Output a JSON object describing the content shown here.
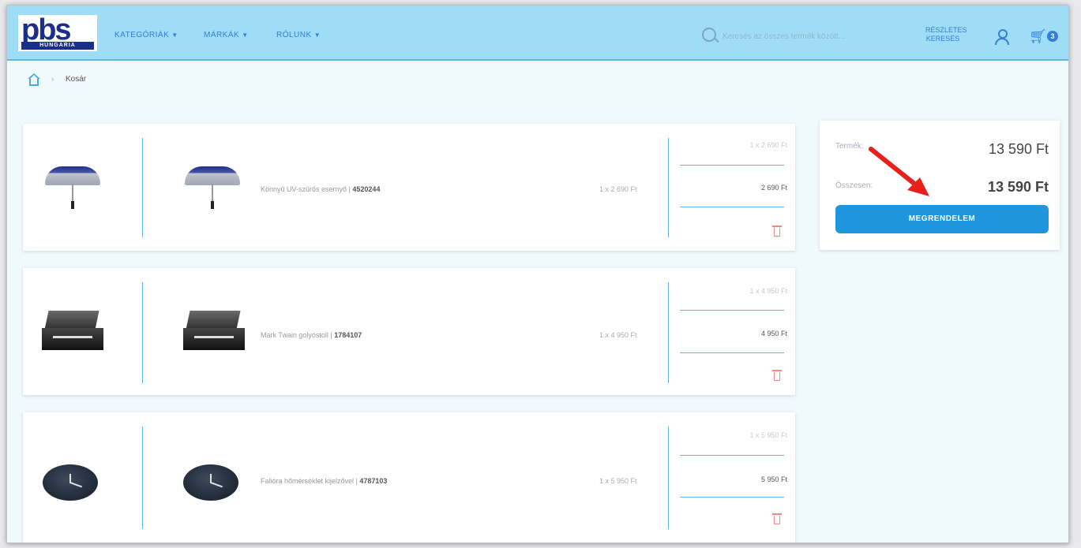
{
  "logo": {
    "word": "pbs",
    "sub": "HUNGARIA"
  },
  "nav": [
    {
      "label": "KATEGÓRIÁK"
    },
    {
      "label": "MÁRKÁK"
    },
    {
      "label": "RÓLUNK"
    }
  ],
  "search": {
    "placeholder": "Keresés az összes termék között..."
  },
  "advanced_search": "RÉSZLETES KERESÉS",
  "cart": {
    "count": "3"
  },
  "breadcrumb": {
    "separator": "›",
    "current": "Kosár"
  },
  "items": [
    {
      "name": "Könnyű UV-szűrős esernyő",
      "code": "4520244",
      "qty_price": "1 x 2 690 Ft",
      "unit_line": "1 x 2 690 Ft",
      "total": "2 690 Ft"
    },
    {
      "name": "Mark Twain golyóstoll",
      "code": "1784107",
      "qty_price": "1 x 4 950 Ft",
      "unit_line": "1 x 4 950 Ft",
      "total": "4 950 Ft"
    },
    {
      "name": "Falióra hőmérséklet kijelzővel",
      "code": "4787103",
      "qty_price": "1 x 5 950 Ft",
      "unit_line": "1 x 5 950 Ft",
      "total": "5 950 Ft"
    }
  ],
  "summary": {
    "products_label": "Termék:",
    "products_value": "13 590 Ft",
    "total_label": "Összesen:",
    "total_value": "13 590 Ft",
    "order_button": "MEGRENDELEM"
  },
  "colors": {
    "accent": "#1f95dd",
    "header": "#9fdcf6",
    "arrow": "#e8201c"
  }
}
